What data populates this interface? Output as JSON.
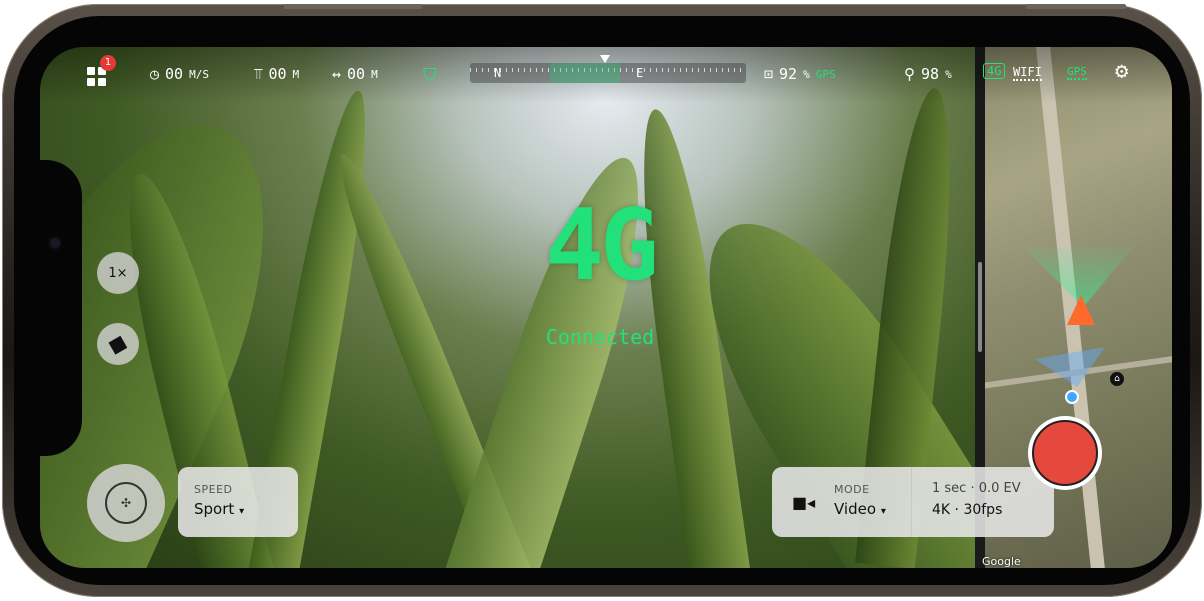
{
  "topbar": {
    "notification_count": "1",
    "speed_value": "00",
    "speed_unit": "M/S",
    "altitude_value": "00",
    "altitude_unit": "M",
    "distance_value": "00",
    "distance_unit": "M",
    "compass_north": "N",
    "compass_east": "E",
    "drone_battery": "92",
    "drone_battery_unit": "%",
    "drone_gps": "GPS",
    "controller_battery": "98",
    "controller_battery_unit": "%",
    "network_4g": "4G",
    "network_wifi": "WIFI",
    "network_gps": "GPS"
  },
  "center": {
    "status_title": "4G",
    "status_subtitle": "Connected"
  },
  "left_controls": {
    "zoom_label": "1×"
  },
  "speed_panel": {
    "label": "SPEED",
    "value": "Sport"
  },
  "mode_panel": {
    "label": "MODE",
    "value": "Video",
    "exposure": "1 sec · 0.0 EV",
    "resolution": "4K · 30fps"
  },
  "map": {
    "attribution": "Google"
  },
  "colors": {
    "accent_green": "#22e07a",
    "record_red": "#e5483c",
    "alert_red": "#e53935",
    "drone_orange": "#ff6a2b"
  },
  "icons": [
    "grid-icon",
    "speedometer-icon",
    "altitude-icon",
    "distance-icon",
    "shield-icon",
    "drone-battery-icon",
    "controller-icon",
    "gear-icon",
    "camera-switch-icon",
    "video-camera-icon",
    "joystick-icon",
    "home-icon"
  ]
}
